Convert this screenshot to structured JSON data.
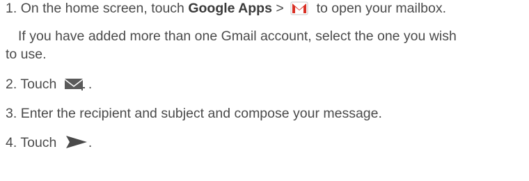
{
  "steps": {
    "s1": {
      "number": "1.",
      "text_before": "On the home screen, touch",
      "bold": "Google Apps",
      "sep": ">",
      "icon": "gmail-icon",
      "text_after": "to open your mailbox."
    },
    "note": {
      "line1": "If you have added more than one Gmail account, select the one you wish",
      "line2": "to use."
    },
    "s2": {
      "number": "2.",
      "text": "Touch",
      "icon": "compose-mail-icon",
      "end": "."
    },
    "s3": {
      "number": "3.",
      "text": "Enter the recipient and subject and compose your message."
    },
    "s4": {
      "number": "4.",
      "text": "Touch",
      "icon": "send-arrow-icon",
      "end": "."
    }
  }
}
